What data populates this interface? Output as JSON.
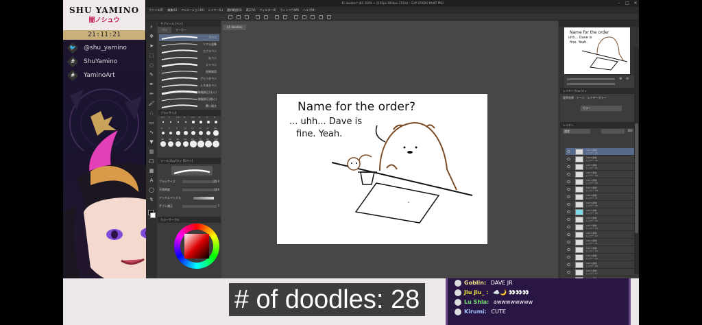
{
  "overlay": {
    "brand_name": "SHU YAMINO",
    "brand_sub": "闇ノシュウ",
    "clock": "21:11:21",
    "socials": [
      {
        "icon": "twitter-icon",
        "label": "@shu_yamino"
      },
      {
        "icon": "hashtag-icon",
        "label": "ShuYamino"
      },
      {
        "icon": "hashtag-icon",
        "label": "YaminoArt"
      }
    ],
    "counter": "# of doodles: 28",
    "accent": "#c2205a"
  },
  "app": {
    "title": "41 doodles* (B5 350% + 2150px 3004px 2720s) - CLIP STUDIO PAINT PRO",
    "menu": [
      "ファイル(F)",
      "編集(E)",
      "アニメーション(A)",
      "レイヤー(L)",
      "選択範囲(S)",
      "表示(V)",
      "フィルター(I)",
      "ウィンドウ(W)",
      "ヘルプ(H)"
    ],
    "document_tab": "41 doodles"
  },
  "subtool": {
    "header": "サブツール [ペン]",
    "tabs": [
      "ペン",
      "マーカー"
    ],
    "brushes": [
      "Gペン",
      "リアル鉛筆",
      "カブラペン",
      "丸ペン",
      "ミリペン",
      "効果線用",
      "ざらつきペン",
      "入り抜きペン",
      "線幅修正(太く)",
      "線幅修正(細く)",
      "覆い焼き"
    ]
  },
  "brush_size": {
    "header": "ブラシサイズ",
    "sizes": [
      "0.7",
      "1",
      "1.5",
      "2",
      "2.5",
      "3",
      "4",
      "5",
      "6",
      "7",
      "8",
      "10",
      "12",
      "15",
      "17",
      "20",
      "25",
      "30",
      "40",
      "50",
      "60",
      "70",
      "80",
      "100"
    ]
  },
  "tool_property": {
    "header": "ツールプロパティ [Gペン]",
    "rows": [
      {
        "label": "ブラシサイズ",
        "value": "25.0"
      },
      {
        "label": "不透明度",
        "value": "100"
      },
      {
        "label": "アンチエイリアス",
        "value": ""
      },
      {
        "label": "手ブレ補正",
        "value": "7"
      }
    ]
  },
  "color": {
    "header": "カラーサークル"
  },
  "canvas": {
    "text_line1": "Name for the order?",
    "text_line2": "... uhh... Dave is",
    "text_line3": "fine.  Yeah."
  },
  "navigator": {
    "thumb_line1": "Name for the order",
    "thumb_line2": "uhh... Dave is",
    "thumb_line3": "fine. Yeah."
  },
  "layer_property": {
    "header": "レイヤープロパティ",
    "options": [
      "境界効果",
      "トーン",
      "レイヤーカラー"
    ],
    "expression_color": "カラー"
  },
  "layers": {
    "header": "レイヤー",
    "blend": "通常",
    "opacity": "100",
    "items": [
      {
        "pct": "100 %通常",
        "name": "レイヤー 33"
      },
      {
        "pct": "100 %通常",
        "name": "レイヤー 32"
      },
      {
        "pct": "100 %通常",
        "name": "レイヤー 31"
      },
      {
        "pct": "100 %通常",
        "name": "レイヤー 30"
      },
      {
        "pct": "100 %通常",
        "name": "レイヤー 29"
      },
      {
        "pct": "100 %通常",
        "name": "レイヤー 28"
      },
      {
        "pct": "100 %通常",
        "name": "レイヤー 27"
      },
      {
        "pct": "100 %通常",
        "name": "レイヤー 26"
      },
      {
        "pct": "100 %通常",
        "name": "レイヤー 25"
      },
      {
        "pct": "100 %通常",
        "name": "レイヤー 24"
      },
      {
        "pct": "100 %通常",
        "name": "レイヤー 23"
      },
      {
        "pct": "100 %通常",
        "name": "レイヤー 22"
      },
      {
        "pct": "100 %通常",
        "name": "レイヤー 21"
      },
      {
        "pct": "100 %通常",
        "name": "レイヤー 20"
      },
      {
        "pct": "100 %通常",
        "name": "レイヤー 19"
      },
      {
        "pct": "100 %通常",
        "name": "レイヤー 18"
      },
      {
        "pct": "100 %通常",
        "name": "レイヤー 17"
      },
      {
        "pct": "100 %通常",
        "name": "レイヤー 16"
      }
    ]
  },
  "chat": [
    {
      "user": "Goblin:",
      "message": "DAVE JR",
      "color": "#f0e28a"
    },
    {
      "user": "Jiu Jiu_ :",
      "message": "☁️🌙 👀👀👀",
      "color": "#e8e23a"
    },
    {
      "user": "Lu Shia:",
      "message": "awwwwwwww",
      "color": "#6ee06a"
    },
    {
      "user": "Kirumi:",
      "message": "CUTE",
      "color": "#9fc3ff"
    }
  ]
}
